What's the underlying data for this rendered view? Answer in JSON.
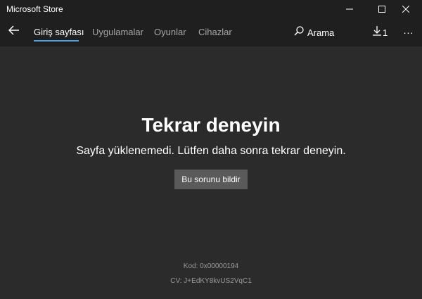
{
  "window": {
    "title": "Microsoft Store"
  },
  "nav": {
    "tabs": [
      {
        "label": "Giriş sayfası",
        "active": true
      },
      {
        "label": "Uygulamalar",
        "active": false
      },
      {
        "label": "Oyunlar",
        "active": false
      },
      {
        "label": "Cihazlar",
        "active": false
      }
    ],
    "search_label": "Arama",
    "downloads_count": "1",
    "more_label": "..."
  },
  "error": {
    "title": "Tekrar deneyin",
    "message": "Sayfa yüklenemedi. Lütfen daha sonra tekrar deneyin.",
    "report_button": "Bu sorunu bildir",
    "code": "Kod: 0x00000194",
    "cv": "CV: J+EdKY8kvUS2VqC1"
  },
  "colors": {
    "background": "#2b2b2b",
    "bar_background": "#1f1f1f",
    "accent": "#4aa0e6",
    "button": "#5a5a5a"
  },
  "icons": {
    "back": "arrow-left-icon",
    "minimize": "minimize-icon",
    "maximize": "maximize-icon",
    "close": "close-icon",
    "search": "search-icon",
    "downloads": "download-icon",
    "more": "more-icon"
  }
}
